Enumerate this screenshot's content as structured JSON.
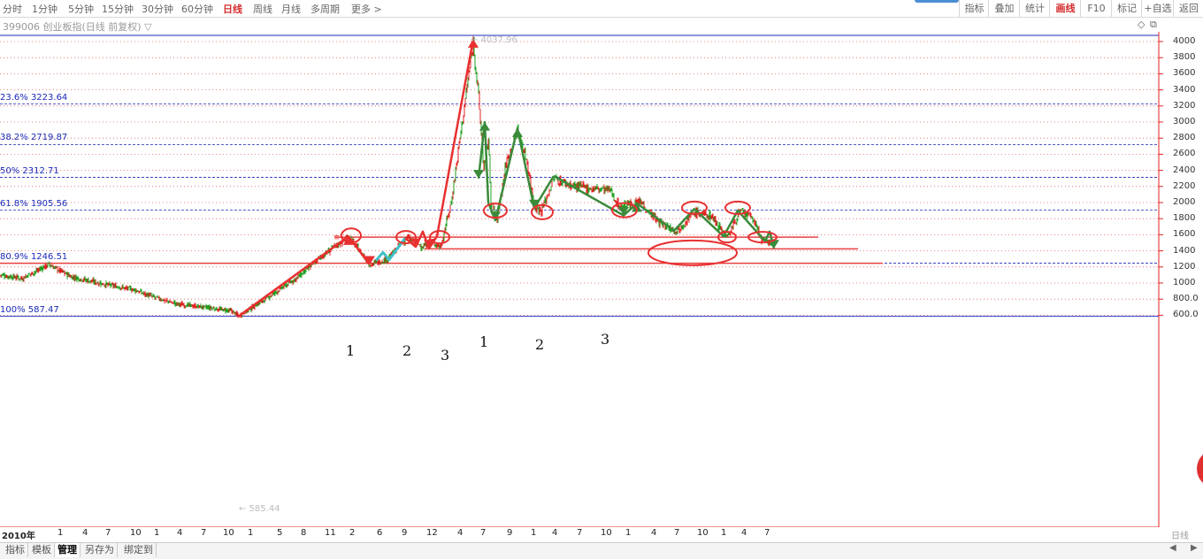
{
  "toolbar": {
    "periods": [
      "分时",
      "1分钟",
      "5分钟",
      "15分钟",
      "30分钟",
      "60分钟",
      "日线",
      "周线",
      "月线",
      "多周期",
      "更多 >"
    ],
    "active_period": "日线",
    "right_tools": [
      "指标",
      "叠加",
      "统计",
      "画线",
      "F10",
      "标记",
      "+自选",
      "返回"
    ],
    "active_tool": "画线"
  },
  "chart_header": {
    "title": "399006 创业板指(日线 前复权) ▽",
    "controls": [
      "◇",
      "⧉"
    ]
  },
  "price_axis": {
    "labels": [
      "4000",
      "3800",
      "3600",
      "3400",
      "3200",
      "3000",
      "2800",
      "2600",
      "2400",
      "2200",
      "2000",
      "1800",
      "1600",
      "1400",
      "1200",
      "1000",
      "800.0",
      "600.0"
    ]
  },
  "fib_levels": [
    {
      "label": "23.6% 3223.64",
      "value": 3223.64
    },
    {
      "label": "38.2% 2719.87",
      "value": 2719.87
    },
    {
      "label": "50% 2312.71",
      "value": 2312.71
    },
    {
      "label": "61.8% 1905.56",
      "value": 1905.56
    },
    {
      "label": "80.9% 1246.51",
      "value": 1246.51
    },
    {
      "label": "100% 587.47",
      "value": 587.47
    }
  ],
  "annotations": {
    "high_label": "← 4037.96",
    "low_label": "← 585.44"
  },
  "wave_labels_left": [
    "1",
    "2",
    "3"
  ],
  "wave_labels_right": [
    "1",
    "2",
    "3"
  ],
  "time_axis": {
    "year": "2010年",
    "ticks": [
      "1",
      "4",
      "7",
      "10",
      "1",
      "4",
      "7",
      "10",
      "1",
      "5",
      "8",
      "11",
      "2",
      "6",
      "9",
      "12",
      "4",
      "7",
      "9",
      "1",
      "4",
      "7",
      "10",
      "1",
      "4",
      "7",
      "10",
      "1",
      "4",
      "7"
    ],
    "period_label": "日线"
  },
  "bottom_tabs": [
    "指标",
    "模板",
    "管理",
    "另存为",
    "绑定到"
  ],
  "active_bottom_tab": "管理",
  "nav": {
    "left": "◀",
    "right": "▶"
  },
  "colors": {
    "candle_up": "#e02020",
    "candle_down": "#20a020",
    "fib_line": "#1a2ab8",
    "support_line": "#e84040",
    "wave_red": "#e83030",
    "wave_green": "#3a8a3a",
    "wave_cyan": "#40c0c8"
  },
  "chart_data": {
    "type": "line",
    "title": "399006 创业板指(日线 前复权)",
    "ylim": [
      600,
      4000
    ],
    "series": [
      {
        "name": "创业板指",
        "x": [
          "2010-06",
          "2011-01",
          "2012-12",
          "2013-09",
          "2014-02",
          "2015-06",
          "2015-09",
          "2016-02",
          "2016-08",
          "2017-01",
          "2017-07",
          "2018-02",
          "2018-06"
        ],
        "values": [
          1000,
          1160,
          585.44,
          1420,
          1230,
          4037.96,
          1820,
          1900,
          2300,
          1900,
          1700,
          1900,
          1500
        ]
      }
    ],
    "horizontal_lines": [
      1905.56,
      1570,
      1425,
      1246.51
    ]
  }
}
